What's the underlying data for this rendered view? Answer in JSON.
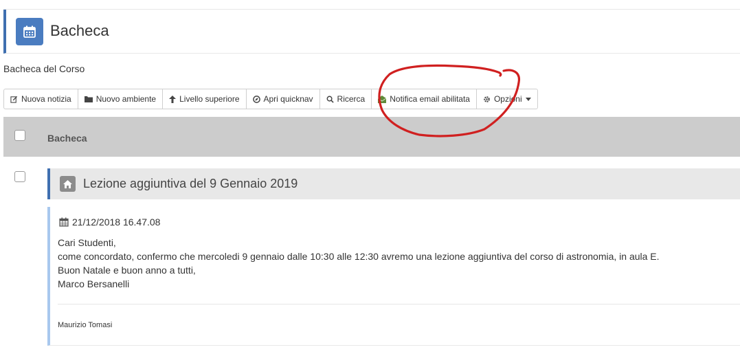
{
  "page": {
    "title": "Bacheca",
    "subtitle": "Bacheca del Corso"
  },
  "icons": {
    "header": "calendar-icon",
    "item": "home-icon",
    "date": "calendar-icon"
  },
  "colors": {
    "accent": "#3f6fb0",
    "header_icon_bg": "#4a7cc0",
    "list_header_bg": "#cccccc",
    "item_title_bg": "#e8e8e8",
    "body_accent": "#a8c8ee",
    "email_icon": "#5f8a3a",
    "annotation": "#d02020"
  },
  "toolbar": {
    "buttons": [
      {
        "label": "Nuova notizia",
        "icon": "edit-icon"
      },
      {
        "label": "Nuovo ambiente",
        "icon": "folder-icon"
      },
      {
        "label": "Livello superiore",
        "icon": "arrow-up-icon"
      },
      {
        "label": "Apri quicknav",
        "icon": "compass-icon"
      },
      {
        "label": "Ricerca",
        "icon": "search-icon"
      },
      {
        "label": "Notifica email abilitata",
        "icon": "envelope-open-icon"
      },
      {
        "label": "Opzioni",
        "icon": "gear-icon"
      }
    ]
  },
  "list": {
    "header_label": "Bacheca"
  },
  "item": {
    "title": "Lezione aggiuntiva del 9 Gennaio 2019",
    "date": "21/12/2018 16.47.08",
    "lines": [
      "Cari Studenti,",
      "come concordato, confermo che mercoledi 9 gennaio dalle 10:30 alle 12:30 avremo una lezione aggiuntiva del corso di astronomia, in aula E.",
      "Buon Natale e buon anno a tutti,",
      "Marco Bersanelli"
    ],
    "author": "Maurizio Tomasi"
  }
}
